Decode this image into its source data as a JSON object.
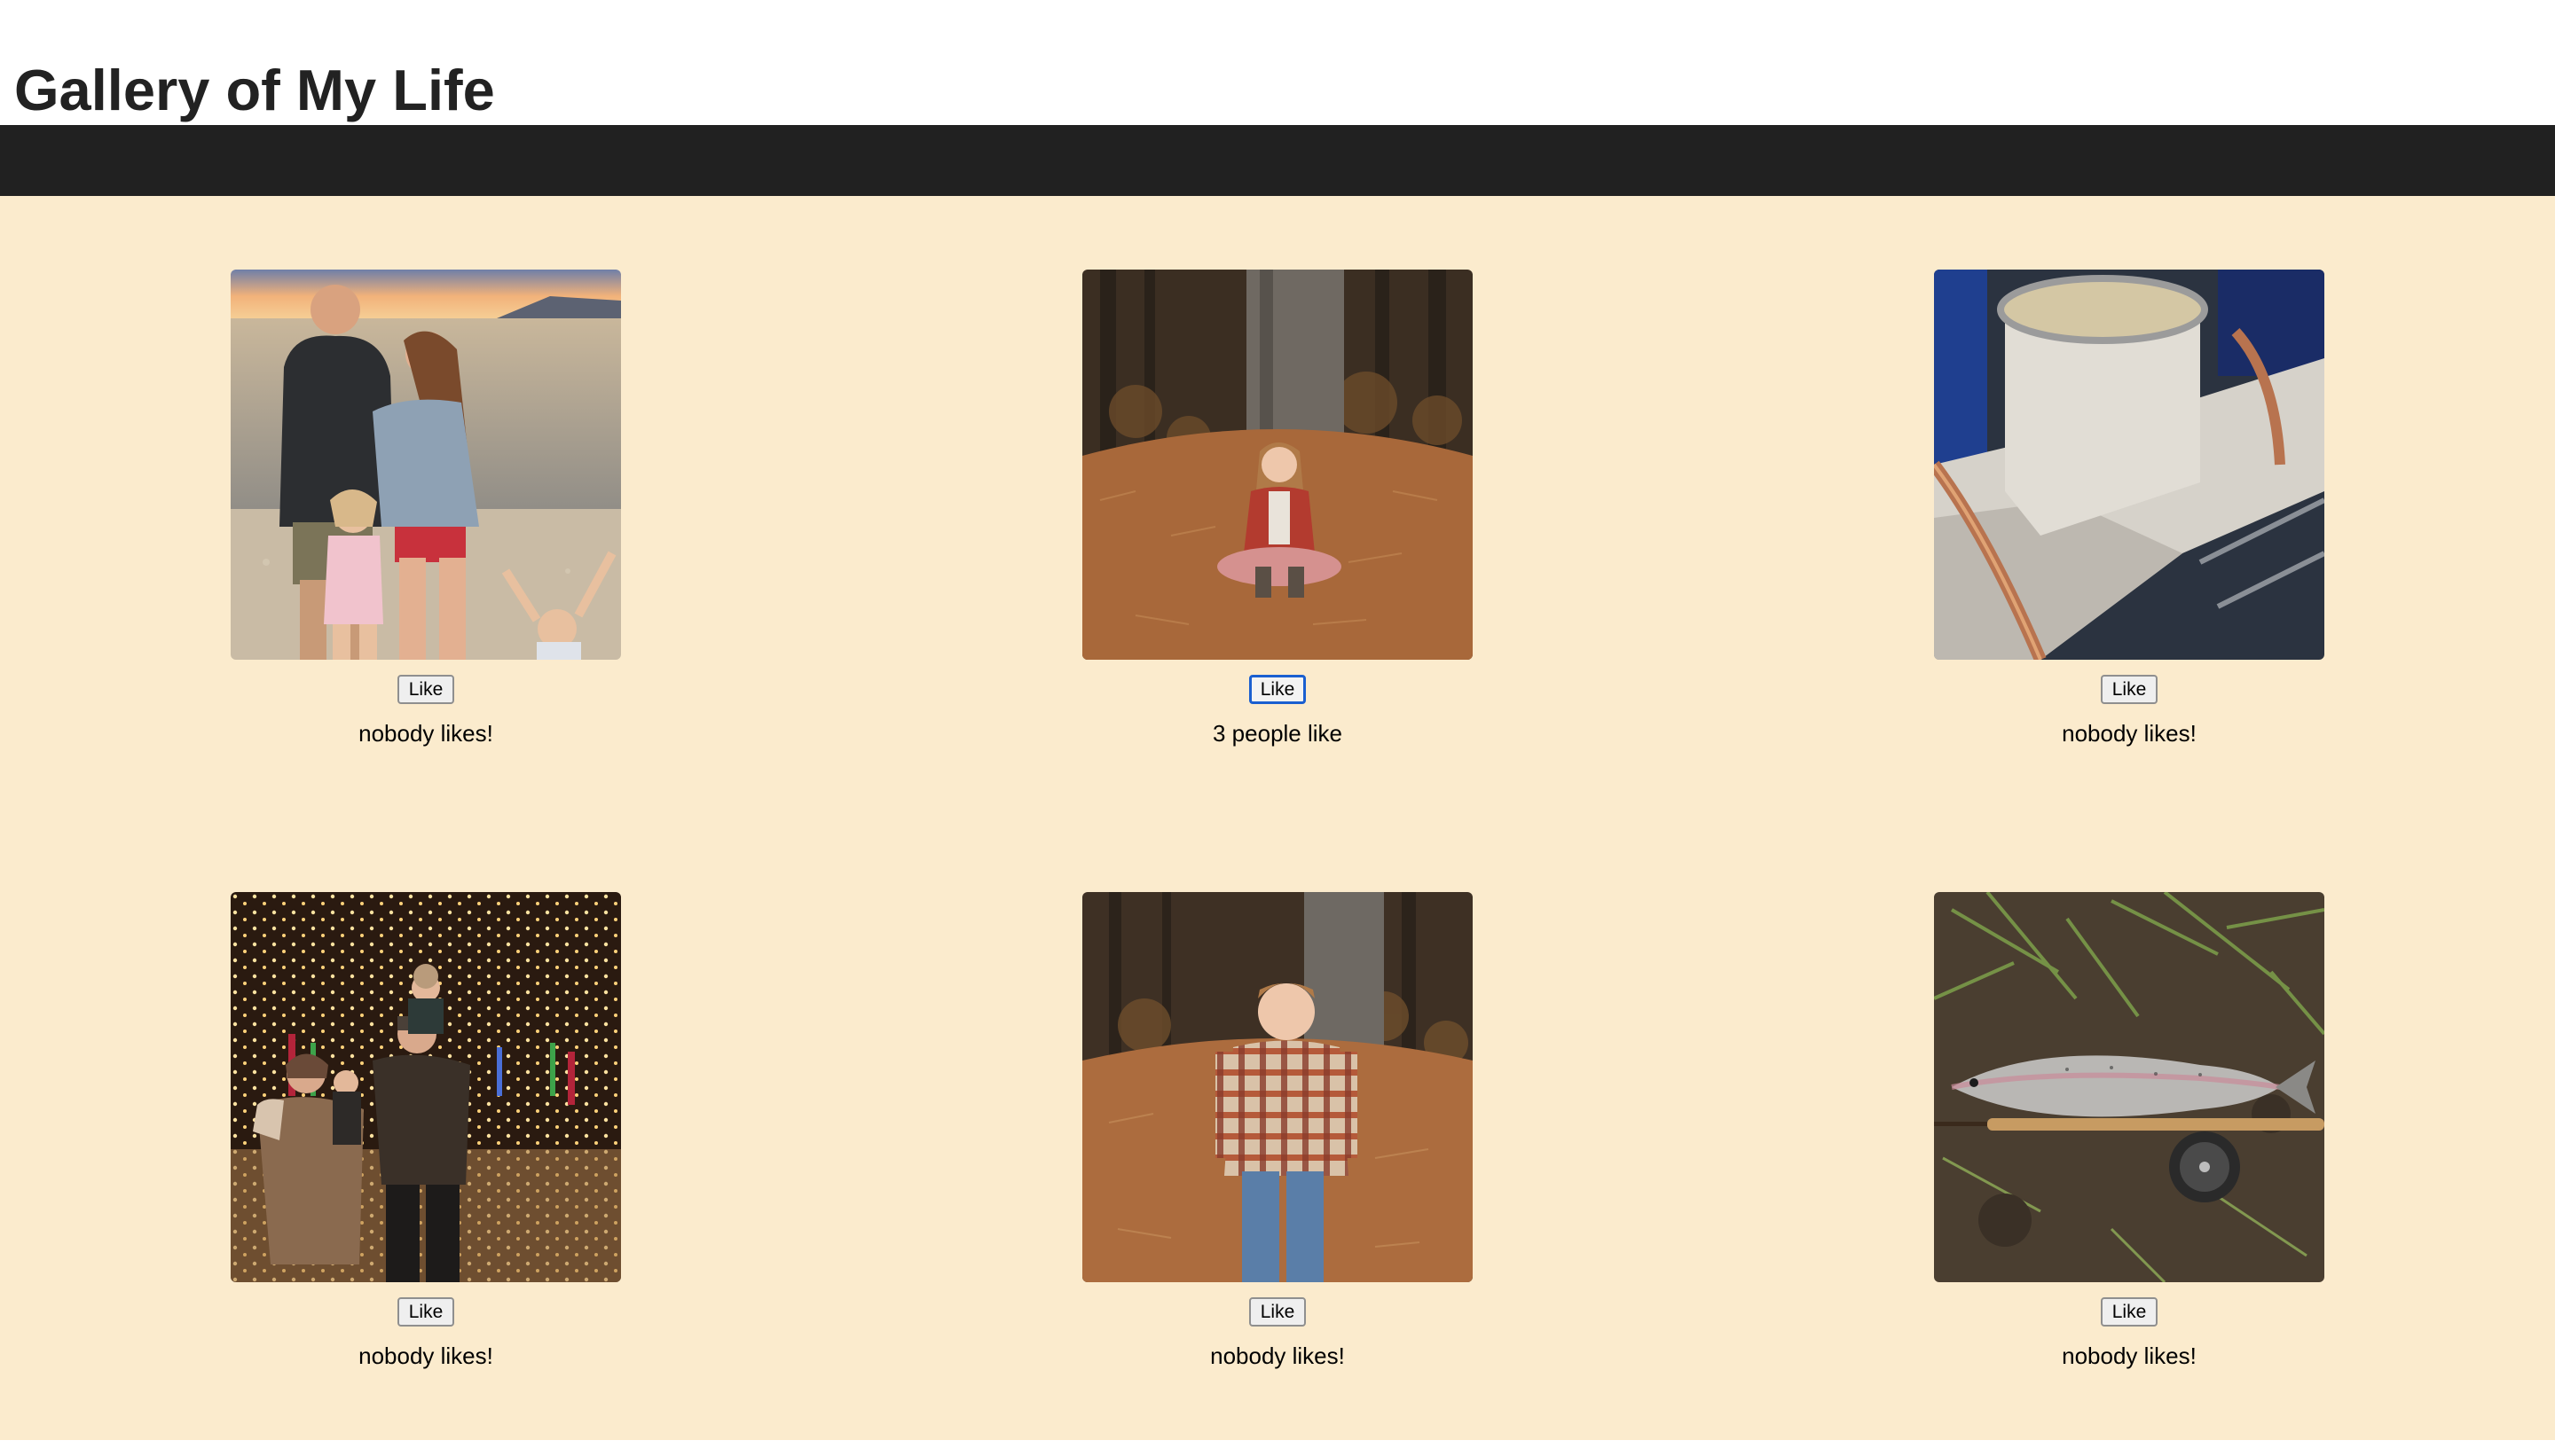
{
  "page": {
    "title": "Gallery of My Life"
  },
  "colors": {
    "navbar": "#212121",
    "background": "#fbebcd",
    "title": "#222222",
    "focus_ring": "#1a5fd0"
  },
  "gallery": {
    "items": [
      {
        "image": "family-beach-sunset-photo",
        "like_label": "Like",
        "likes_text": "nobody likes!"
      },
      {
        "image": "girl-sitting-in-pine-needles-photo",
        "like_label": "Like",
        "likes_text": "3 people like",
        "focused": true
      },
      {
        "image": "welded-pipe-tee-photo",
        "like_label": "Like",
        "likes_text": "nobody likes!"
      },
      {
        "image": "family-christmas-lights-photo",
        "like_label": "Like",
        "likes_text": "nobody likes!"
      },
      {
        "image": "boy-in-plaid-shirt-photo",
        "like_label": "Like",
        "likes_text": "nobody likes!"
      },
      {
        "image": "trout-and-fly-rod-photo",
        "like_label": "Like",
        "likes_text": "nobody likes!"
      }
    ]
  }
}
